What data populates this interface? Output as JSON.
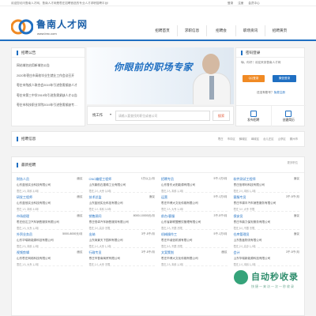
{
  "topbar": {
    "welcome": "欢迎您访问鲁南人才网，鲁南人才网是枣庄招聘首选的专业人才求职招聘平台!",
    "links": [
      "登录",
      "注册",
      "会员中心"
    ]
  },
  "header": {
    "site_title": "鲁南人才网",
    "site_url": "www.lnrc.com",
    "nav": [
      "招聘首页",
      "求职信息",
      "招聘会",
      "职场资讯",
      "招聘黄页"
    ]
  },
  "notice": {
    "title": "招聘公告",
    "items": [
      "网站域名启用新域名公告",
      "2020年枣庄市高校毕业生就业工作会议召开",
      "枣庄市残疾人联合会2019年引进急需紧缺人才",
      "枣庄市第三中学2019年引进急需紧缺人才公告",
      "枣庄市科技职业学院2019年引进急需紧缺专业技术人才"
    ]
  },
  "banner": {
    "slogan": "你眼前的职场专家"
  },
  "search": {
    "category": "找工作",
    "placeholder": "请输入要查找的职位或者公司",
    "button": "搜索"
  },
  "login": {
    "title": "密码登录",
    "welcome_msg": "嗨，你好！欢迎来到鲁南人才网",
    "qq_button": "QQ登录",
    "wx_button": "微信登录",
    "register_prefix": "还没有账号？",
    "register_link": "免费注册",
    "actions": [
      "发布招聘",
      "创建简历"
    ]
  },
  "recruit": {
    "title": "招聘信息",
    "cities": [
      "枣庄",
      "市中区",
      "薛城区",
      "峄城区",
      "台儿庄区",
      "山亭区",
      "滕州市"
    ]
  },
  "jobs": {
    "title": "最新招聘",
    "more": "更多职位",
    "items": [
      {
        "title": "财务人员",
        "salary": "面议",
        "company": "山东蓝冠实业科技有限公司",
        "meta": "枣庄 1人 本科 3-5年"
      },
      {
        "title": "CNC编程工程师",
        "salary": "1万以上/月",
        "company": "山东鼎航石墨烯工业有限公司",
        "meta": "枣庄 2人 大专 3-5年"
      },
      {
        "title": "招聘专员",
        "salary": "5千-1万/月",
        "company": "山东鲁东太阳能源有限公司",
        "meta": "枣庄 2人 本科 1-3年"
      },
      {
        "title": "软件测试工程师",
        "salary": "面议",
        "company": "枣庄信得利科技有限公司",
        "meta": "枣庄 2人 本科 1-3年"
      },
      {
        "title": "研发工程师",
        "salary": "面议",
        "company": "山东蓝冠实业科技有限公司",
        "meta": "枣庄 1人 本科 3-5年"
      },
      {
        "title": "技术总监",
        "salary": "面议",
        "company": "山东蓝冠实业科技有限公司",
        "meta": "枣庄 1人 本科 3-5年"
      },
      {
        "title": "运营",
        "salary": "5千-1万/月",
        "company": "枣庄市博大文化传媒有限公司",
        "meta": "枣庄 2人 大专 1-3年"
      },
      {
        "title": "客服专员",
        "salary": "3千-5千/月",
        "company": "枣庄市锦丰汽车销售服务有限公司",
        "meta": "枣庄 3人 大专 不限"
      },
      {
        "title": "市场经理",
        "salary": "面议",
        "company": "枣庄信达卫汽车销售服务有限公司",
        "meta": "枣庄 1人 大专 1-3年"
      },
      {
        "title": "销售顾问",
        "salary": "8000-10000元/月",
        "company": "枣庄恒卓汽车销售服务有限公司",
        "meta": "枣庄 3人 高中 不限"
      },
      {
        "title": "前台/客服",
        "salary": "3千-5千/月",
        "company": "山东省新联盟餐饮管理有限公司",
        "meta": "枣庄 2人 不限 不限"
      },
      {
        "title": "保安员",
        "salary": "面议",
        "company": "枣庄市鼎力保安服务有限公司",
        "meta": "枣庄 5人 不限 不限"
      },
      {
        "title": "外贸业务员",
        "salary": "5000-8000元/月",
        "company": "山东华瑞新能源科技有限公司",
        "meta": "枣庄 2人 本科 1-3年"
      },
      {
        "title": "出纳",
        "salary": "3千-5千/月",
        "company": "山东焕景天下园林有限公司",
        "meta": "枣庄 1人 大专 1-3年"
      },
      {
        "title": "机械操作工",
        "salary": "5千-1万/月",
        "company": "枣庄市诚信机械有限公司",
        "meta": "枣庄 5人 不限 不限"
      },
      {
        "title": "仓库管理员",
        "salary": "面议",
        "company": "山东鲁鑫物流有限公司",
        "meta": "枣庄 2人 高中 1-3年"
      },
      {
        "title": "视频剪辑",
        "salary": "面议",
        "company": "山东枣庄网络科技有限公司",
        "meta": "枣庄 1人 大专 1-3年"
      },
      {
        "title": "行政专员",
        "salary": "3千-5千/月",
        "company": "枣庄市鲁南商贸有限公司",
        "meta": "枣庄 1人 大专 不限"
      },
      {
        "title": "文案策划",
        "salary": "面议",
        "company": "枣庄市博大文化传媒有限公司",
        "meta": "枣庄 2人 本科 1-3年"
      },
      {
        "title": "会计",
        "salary": "3千-5千/月",
        "company": "山东华瑞新能源科技有限公司",
        "meta": "枣庄 1人 本科 1-3年"
      }
    ]
  },
  "watermark": {
    "text": "自动秒收录",
    "sub": "快捷一来访一次一秒收录"
  },
  "colors": {
    "brand_blue": "#1f6fc2",
    "qq_orange": "#f08a24",
    "search_red": "#e25b3a",
    "watermark_green": "#2e8d6c"
  }
}
